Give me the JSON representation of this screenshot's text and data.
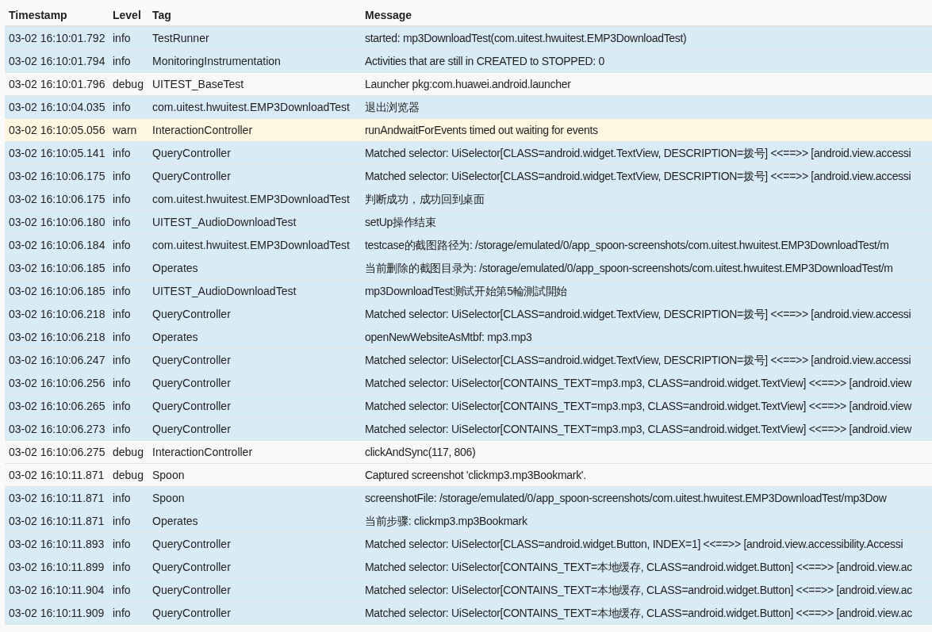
{
  "table": {
    "columns": [
      "Timestamp",
      "Level",
      "Tag",
      "Message"
    ],
    "rows": [
      {
        "timestamp": "03-02 16:10:01.792",
        "level": "info",
        "tag": "TestRunner",
        "message": "started: mp3DownloadTest(com.uitest.hwuitest.EMP3DownloadTest)"
      },
      {
        "timestamp": "03-02 16:10:01.794",
        "level": "info",
        "tag": "MonitoringInstrumentation",
        "message": "Activities that are still in CREATED to STOPPED: 0"
      },
      {
        "timestamp": "03-02 16:10:01.796",
        "level": "debug",
        "tag": "UITEST_BaseTest",
        "message": "Launcher pkg:com.huawei.android.launcher"
      },
      {
        "timestamp": "03-02 16:10:04.035",
        "level": "info",
        "tag": "com.uitest.hwuitest.EMP3DownloadTest",
        "message": "退出浏览器"
      },
      {
        "timestamp": "03-02 16:10:05.056",
        "level": "warn",
        "tag": "InteractionController",
        "message": "runAndwaitForEvents timed out waiting for events"
      },
      {
        "timestamp": "03-02 16:10:05.141",
        "level": "info",
        "tag": "QueryController",
        "message": "Matched selector: UiSelector[CLASS=android.widget.TextView, DESCRIPTION=拨号] <<==>> [android.view.accessi"
      },
      {
        "timestamp": "03-02 16:10:06.175",
        "level": "info",
        "tag": "QueryController",
        "message": "Matched selector: UiSelector[CLASS=android.widget.TextView, DESCRIPTION=拨号] <<==>> [android.view.accessi"
      },
      {
        "timestamp": "03-02 16:10:06.175",
        "level": "info",
        "tag": "com.uitest.hwuitest.EMP3DownloadTest",
        "message": "判断成功，成功回到桌面"
      },
      {
        "timestamp": "03-02 16:10:06.180",
        "level": "info",
        "tag": "UITEST_AudioDownloadTest",
        "message": "setUp操作结束"
      },
      {
        "timestamp": "03-02 16:10:06.184",
        "level": "info",
        "tag": "com.uitest.hwuitest.EMP3DownloadTest",
        "message": "testcase的截图路径为: /storage/emulated/0/app_spoon-screenshots/com.uitest.hwuitest.EMP3DownloadTest/m"
      },
      {
        "timestamp": "03-02 16:10:06.185",
        "level": "info",
        "tag": "Operates",
        "message": "当前删除的截图目录为: /storage/emulated/0/app_spoon-screenshots/com.uitest.hwuitest.EMP3DownloadTest/m"
      },
      {
        "timestamp": "03-02 16:10:06.185",
        "level": "info",
        "tag": "UITEST_AudioDownloadTest",
        "message": "mp3DownloadTest测试开始第5輪測試開始"
      },
      {
        "timestamp": "03-02 16:10:06.218",
        "level": "info",
        "tag": "QueryController",
        "message": "Matched selector: UiSelector[CLASS=android.widget.TextView, DESCRIPTION=拨号] <<==>> [android.view.accessi"
      },
      {
        "timestamp": "03-02 16:10:06.218",
        "level": "info",
        "tag": "Operates",
        "message": "openNewWebsiteAsMtbf: mp3.mp3"
      },
      {
        "timestamp": "03-02 16:10:06.247",
        "level": "info",
        "tag": "QueryController",
        "message": "Matched selector: UiSelector[CLASS=android.widget.TextView, DESCRIPTION=拨号] <<==>> [android.view.accessi"
      },
      {
        "timestamp": "03-02 16:10:06.256",
        "level": "info",
        "tag": "QueryController",
        "message": "Matched selector: UiSelector[CONTAINS_TEXT=mp3.mp3, CLASS=android.widget.TextView] <<==>> [android.view"
      },
      {
        "timestamp": "03-02 16:10:06.265",
        "level": "info",
        "tag": "QueryController",
        "message": "Matched selector: UiSelector[CONTAINS_TEXT=mp3.mp3, CLASS=android.widget.TextView] <<==>> [android.view"
      },
      {
        "timestamp": "03-02 16:10:06.273",
        "level": "info",
        "tag": "QueryController",
        "message": "Matched selector: UiSelector[CONTAINS_TEXT=mp3.mp3, CLASS=android.widget.TextView] <<==>> [android.view"
      },
      {
        "timestamp": "03-02 16:10:06.275",
        "level": "debug",
        "tag": "InteractionController",
        "message": "clickAndSync(117, 806)"
      },
      {
        "timestamp": "03-02 16:10:11.871",
        "level": "debug",
        "tag": "Spoon",
        "message": "Captured screenshot 'clickmp3.mp3Bookmark'."
      },
      {
        "timestamp": "03-02 16:10:11.871",
        "level": "info",
        "tag": "Spoon",
        "message": "screenshotFile: /storage/emulated/0/app_spoon-screenshots/com.uitest.hwuitest.EMP3DownloadTest/mp3Dow"
      },
      {
        "timestamp": "03-02 16:10:11.871",
        "level": "info",
        "tag": "Operates",
        "message": "当前步骤: clickmp3.mp3Bookmark"
      },
      {
        "timestamp": "03-02 16:10:11.893",
        "level": "info",
        "tag": "QueryController",
        "message": "Matched selector: UiSelector[CLASS=android.widget.Button, INDEX=1] <<==>> [android.view.accessibility.Accessi"
      },
      {
        "timestamp": "03-02 16:10:11.899",
        "level": "info",
        "tag": "QueryController",
        "message": "Matched selector: UiSelector[CONTAINS_TEXT=本地缓存, CLASS=android.widget.Button] <<==>> [android.view.ac"
      },
      {
        "timestamp": "03-02 16:10:11.904",
        "level": "info",
        "tag": "QueryController",
        "message": "Matched selector: UiSelector[CONTAINS_TEXT=本地缓存, CLASS=android.widget.Button] <<==>> [android.view.ac"
      },
      {
        "timestamp": "03-02 16:10:11.909",
        "level": "info",
        "tag": "QueryController",
        "message": "Matched selector: UiSelector[CONTAINS_TEXT=本地缓存, CLASS=android.widget.Button] <<==>> [android.view.ac"
      }
    ]
  }
}
